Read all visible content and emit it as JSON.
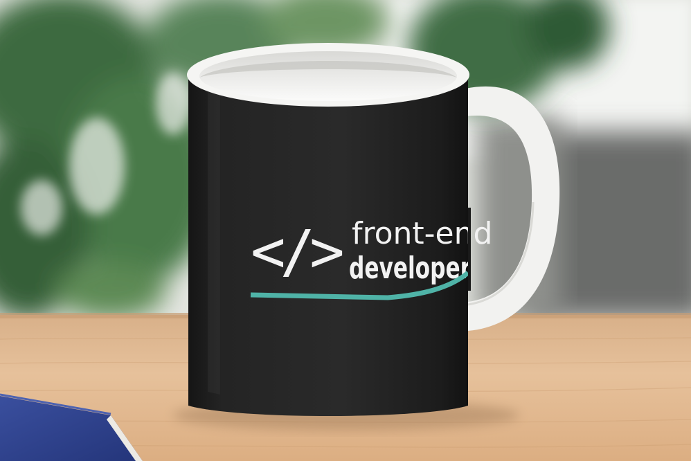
{
  "photo": {
    "subject": "black-ceramic-mug",
    "colors": {
      "mug_body": "#222222",
      "mug_rim": "#f4f4f2",
      "print_text": "#f2f2f2",
      "underline_accent": "#4fb3a7",
      "desk_wood": "#e2b98f",
      "foliage": "#3f6f42",
      "book_cover": "#2d3f8a"
    },
    "mug_print": {
      "code_symbol": "</>",
      "line1": "front-end",
      "line2": "developer"
    }
  }
}
